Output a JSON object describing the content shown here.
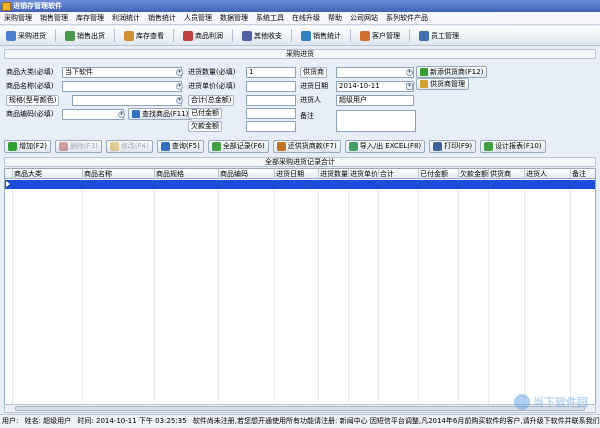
{
  "window": {
    "title": "进销存管理软件"
  },
  "menu": [
    "采购管理",
    "销售管理",
    "库存管理",
    "利润统计",
    "销售统计",
    "人员管理",
    "数据管理",
    "系统工具",
    "在线升级",
    "帮助",
    "公司网站",
    "系列软件产品"
  ],
  "toolbar": [
    {
      "label": "采购进货",
      "icon": "cart-icon",
      "color": "#4a7fd0"
    },
    {
      "label": "销售出货",
      "icon": "sales-icon",
      "color": "#4a9a4a"
    },
    {
      "label": "库存查看",
      "icon": "box-icon",
      "color": "#d09030"
    },
    {
      "label": "商品利润",
      "icon": "profit-icon",
      "color": "#c04040"
    },
    {
      "label": "其他收支",
      "icon": "balance-icon",
      "color": "#5060a0"
    },
    {
      "label": "销售统计",
      "icon": "chart-icon",
      "color": "#3080c0"
    },
    {
      "label": "客户管理",
      "icon": "customer-icon",
      "color": "#d07030"
    },
    {
      "label": "员工管理",
      "icon": "staff-icon",
      "color": "#4070b0"
    }
  ],
  "section": {
    "title": "采购进货"
  },
  "form": {
    "product_class_label": "商品大类(必填)",
    "product_class_value": "当下软件",
    "product_name_label": "商品名称(必填)",
    "product_name_value": "",
    "spec_label": "规格(型号颜色)",
    "spec_value": "",
    "product_code_label": "商品编码(必填)",
    "product_code_value": "",
    "find_product_label": "查找商品(F11)",
    "qty_label": "进货数量(必填)",
    "qty_value": "1",
    "price_label": "进货单价(必填)",
    "price_value": "",
    "total_label": "合计(总金额)",
    "total_value": "",
    "paid_label": "已付金额",
    "paid_value": "",
    "owed_label": "欠款金额",
    "owed_value": "",
    "supplier_label": "供货商",
    "supplier_value": "",
    "date_label": "进货日期",
    "date_value": "2014-10-11",
    "buyer_label": "进货人",
    "buyer_value": "超级用户",
    "remark_label": "备注",
    "remark_value": "",
    "new_supplier_label": "新添供货商(F12)",
    "supplier_manage_label": "供货商管理"
  },
  "actions": [
    {
      "label": "增加(F2)",
      "icon": "add-icon",
      "color": "#30a030",
      "enabled": true
    },
    {
      "label": "删除(F3)",
      "icon": "delete-icon",
      "color": "#c04040",
      "enabled": false
    },
    {
      "label": "修改(F4)",
      "icon": "edit-icon",
      "color": "#d0a030",
      "enabled": false
    },
    {
      "label": "查询(F5)",
      "icon": "search-icon",
      "color": "#3070c0",
      "enabled": true
    },
    {
      "label": "全部记录(F6)",
      "icon": "records-icon",
      "color": "#40a040",
      "enabled": true
    },
    {
      "label": "还供货商款(F7)",
      "icon": "repay-icon",
      "color": "#c07020",
      "enabled": true
    },
    {
      "label": "导入/出 EXCEL(F8)",
      "icon": "excel-icon",
      "color": "#40a060",
      "enabled": true
    },
    {
      "label": "打印(F9)",
      "icon": "print-icon",
      "color": "#4060a0",
      "enabled": true
    },
    {
      "label": "设计报表(F10)",
      "icon": "report-icon",
      "color": "#40a040",
      "enabled": true
    }
  ],
  "grid": {
    "title": "全部采购进货记录合计",
    "columns": [
      "商品大类",
      "商品名称",
      "商品规格",
      "商品编码",
      "进货日期",
      "进货数量",
      "进货单价",
      "合计",
      "已付金额",
      "欠款金额",
      "供货商",
      "进货人",
      "备注"
    ]
  },
  "status": {
    "user": "用户:",
    "name": "姓名: 超级用户",
    "time": "时间: 2014-10-11 下午 03:25:35",
    "message": "软件尚未注册,若您想开通使用所有功能请注册: 新闻中心 因短信平台调整,凡2014年6月前购买软件的客户,请升级下软件并联系我们"
  },
  "watermark": {
    "text": "当下软件园"
  }
}
